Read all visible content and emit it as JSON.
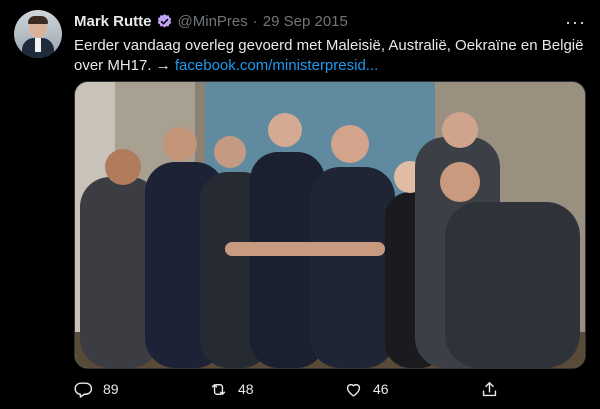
{
  "author": {
    "name": "Mark Rutte",
    "handle": "@MinPres",
    "separator": "·",
    "date": "29 Sep 2015",
    "verified_color": "#c3a3f5"
  },
  "tweet": {
    "text": "Eerder vandaag overleg gevoerd met Maleisië, Australië, Oekraïne en België over MH17. →",
    "link": "facebook.com/ministerpresid...",
    "link_color": "#1d9bf0"
  },
  "more_label": "···",
  "metrics": {
    "replies": "89",
    "retweets": "48",
    "likes": "46"
  },
  "icons": [
    "avatar",
    "verified-badge-icon",
    "more-icon",
    "reply-icon",
    "retweet-icon",
    "like-icon",
    "share-icon"
  ]
}
